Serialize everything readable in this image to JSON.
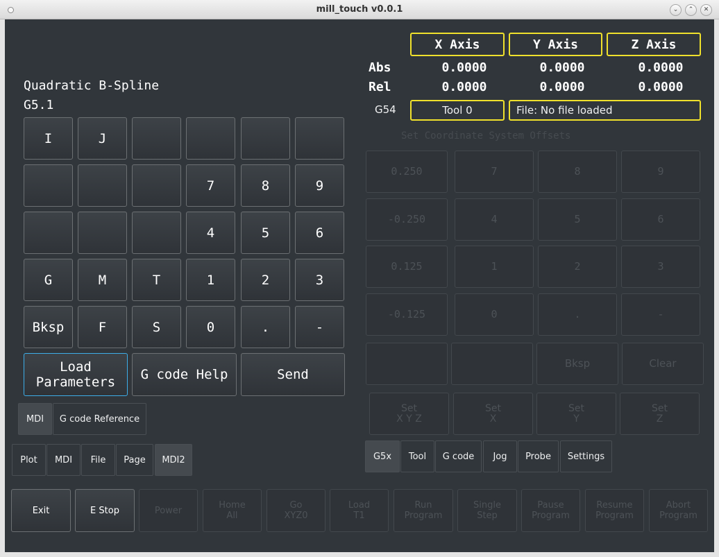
{
  "window": {
    "title": "mill_touch v0.0.1"
  },
  "mdi": {
    "title": "Quadratic B-Spline",
    "gcode": "G5.1",
    "keys": [
      "I",
      "J",
      "",
      "",
      "",
      "",
      "",
      "",
      "",
      "7",
      "8",
      "9",
      "",
      "",
      "",
      "4",
      "5",
      "6",
      "G",
      "M",
      "T",
      "1",
      "2",
      "3",
      "Bksp",
      "F",
      "S",
      "0",
      ".",
      "-"
    ],
    "load_parameters": "Load\nParameters",
    "gcode_help": "G code Help",
    "send": "Send"
  },
  "left_tabs": {
    "mdi": "MDI",
    "gcode_reference": "G code Reference"
  },
  "page_tabs": [
    "Plot",
    "MDI",
    "File",
    "Page",
    "MDI2"
  ],
  "dro": {
    "headers": [
      "X Axis",
      "Y Axis",
      "Z Axis"
    ],
    "abs_label": "Abs",
    "rel_label": "Rel",
    "abs": [
      "0.0000",
      "0.0000",
      "0.0000"
    ],
    "rel": [
      "0.0000",
      "0.0000",
      "0.0000"
    ],
    "coord_system": "G54",
    "tool": "Tool 0",
    "file": "File: No file loaded"
  },
  "offsets": {
    "title": "Set Coordinate System Offsets",
    "rows": [
      [
        "0.250",
        "7",
        "8",
        "9"
      ],
      [
        "-0.250",
        "4",
        "5",
        "6"
      ],
      [
        "0.125",
        "1",
        "2",
        "3"
      ],
      [
        "-0.125",
        "0",
        ".",
        "-"
      ]
    ],
    "row5": [
      "",
      "",
      "Bksp",
      "Clear"
    ],
    "set_buttons": [
      "Set\nX Y Z",
      "Set\nX",
      "Set\nY",
      "Set\nZ"
    ]
  },
  "right_tabs": [
    "G5x",
    "Tool",
    "G code",
    "Jog",
    "Probe",
    "Settings"
  ],
  "controls": [
    "Exit",
    "E Stop",
    "Power",
    "Home\nAll",
    "Go\nXYZ0",
    "Load\nT1",
    "Run\nProgram",
    "Single\nStep",
    "Pause\nProgram",
    "Resume\nProgram",
    "Abort\nProgram"
  ],
  "colors": {
    "background": "#31363b",
    "accent_yellow": "#f0e12c",
    "focus_blue": "#3daee9"
  }
}
